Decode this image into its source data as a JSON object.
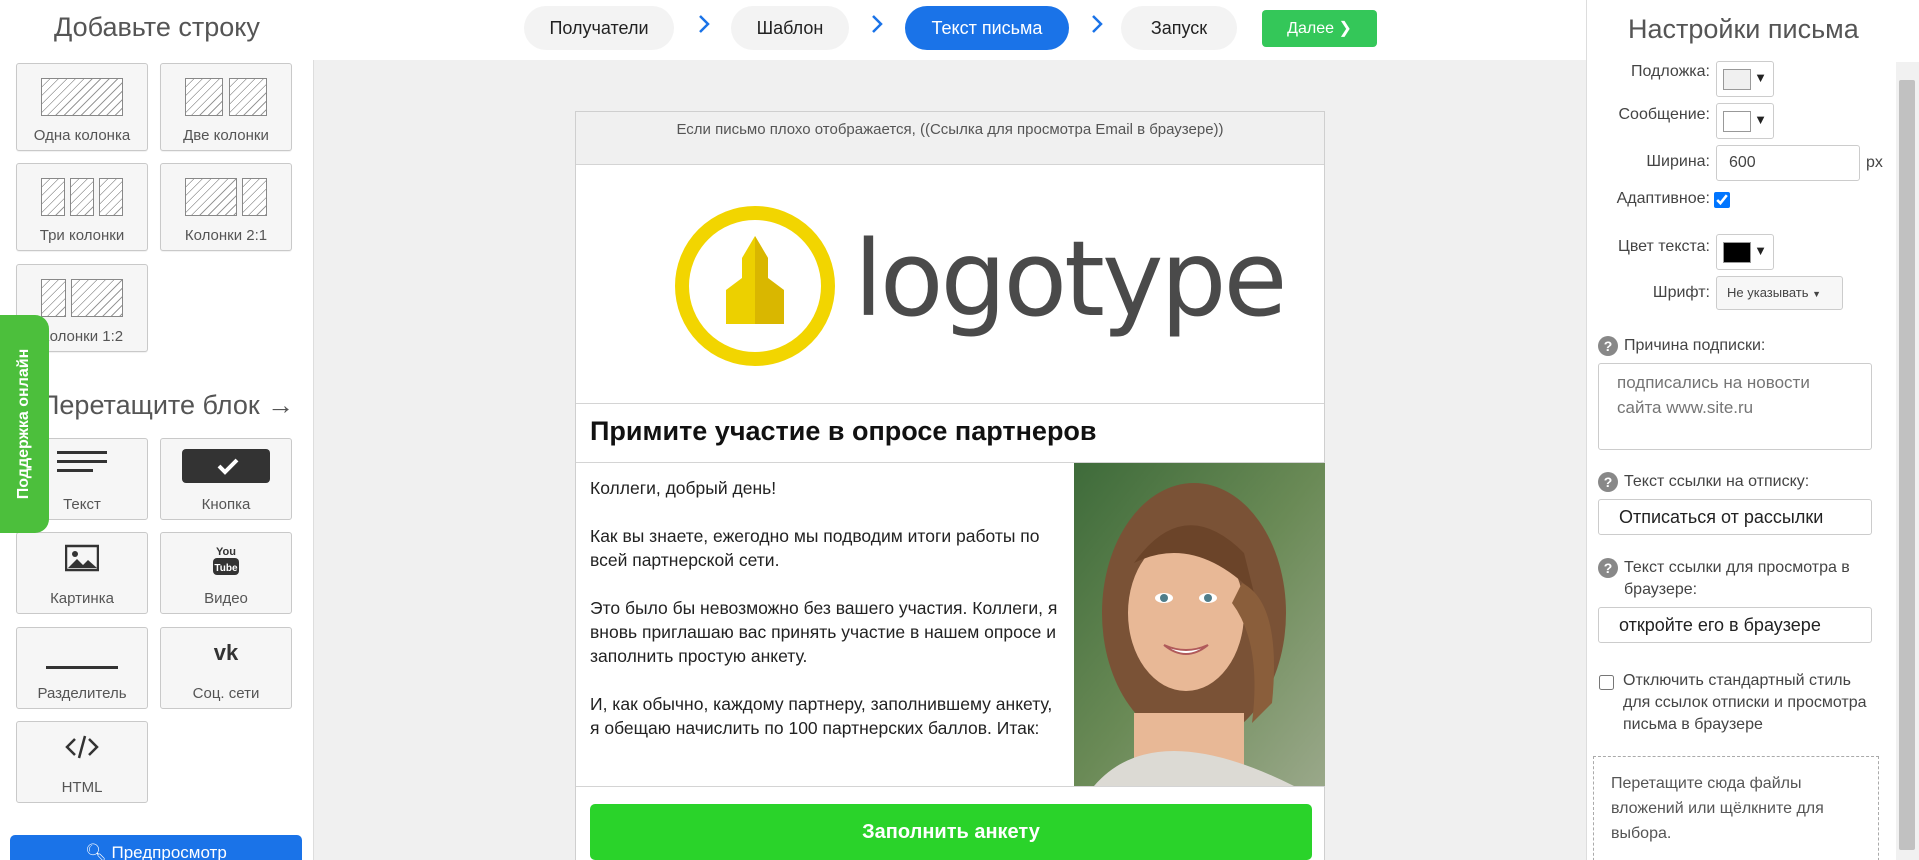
{
  "wizard": {
    "steps": [
      "Получатели",
      "Шаблон",
      "Текст письма",
      "Запуск"
    ],
    "active_step": "Текст письма",
    "next_label": "Далее",
    "accent": "#1a73e8",
    "next_color": "#34c759"
  },
  "left_panel": {
    "rows_title": "Добавьте строку",
    "row_layouts": [
      "Одна колонка",
      "Две колонки",
      "Три колонки",
      "Колонки 2:1",
      "Колонки 1:2"
    ],
    "blocks_title": "Перетащите блок →",
    "blocks": [
      {
        "label": "Текст",
        "icon": "text-lines-icon"
      },
      {
        "label": "Кнопка",
        "icon": "button-check-icon"
      },
      {
        "label": "Картинка",
        "icon": "image-icon"
      },
      {
        "label": "Видео",
        "icon": "youtube-icon"
      },
      {
        "label": "Разделитель",
        "icon": "divider-line-icon"
      },
      {
        "label": "Соц. сети",
        "icon": "vk-icon"
      },
      {
        "label": "HTML",
        "icon": "code-icon"
      }
    ],
    "support_label": "Поддержка онлайн",
    "preview_label": "Предпросмотр"
  },
  "email": {
    "browser_line": "Если письмо плохо отображается, ((Ссылка для просмотра Email в браузере))",
    "logo_text": "logotype",
    "title": "Примите участие в опросе партнеров",
    "paragraphs": [
      "Коллеги, добрый день!",
      "Как вы знаете, ежегодно мы подводим итоги работы по всей партнерской сети.",
      "Это было бы невозможно без вашего участия. Коллеги, я вновь приглашаю вас принять участие в нашем опросе и заполнить простую анкету.",
      "И, как обычно, каждому партнеру, заполнившему анкету, я обещаю начислить по 100 партнерских баллов. Итак:"
    ],
    "cta_label": "Заполнить анкету",
    "cta_color": "#2ad32a"
  },
  "settings": {
    "title": "Настройки письма",
    "background_label": "Подложка:",
    "background_color": "#f0f0f0",
    "message_label": "Сообщение:",
    "message_color": "#ffffff",
    "width_label": "Ширина:",
    "width_value": "600",
    "width_unit": "px",
    "adaptive_label": "Адаптивное:",
    "adaptive_checked": true,
    "text_color_label": "Цвет текста:",
    "text_color": "#000000",
    "font_label": "Шрифт:",
    "font_value": "Не указывать",
    "reason_label": "Причина подписки:",
    "reason_placeholder": "подписались на новости сайта www.site.ru",
    "unsub_label": "Текст ссылки на отписку:",
    "unsub_value": "Отписаться от рассылки",
    "browser_link_label": "Текст ссылки для просмотра в браузере:",
    "browser_link_value": "откройте его в браузере",
    "disable_style_label": "Отключить стандартный стиль для ссылок отписки и просмотра письма в браузере",
    "disable_style_checked": false,
    "dropzone_text": "Перетащите сюда файлы вложений или щёлкните для выбора."
  }
}
